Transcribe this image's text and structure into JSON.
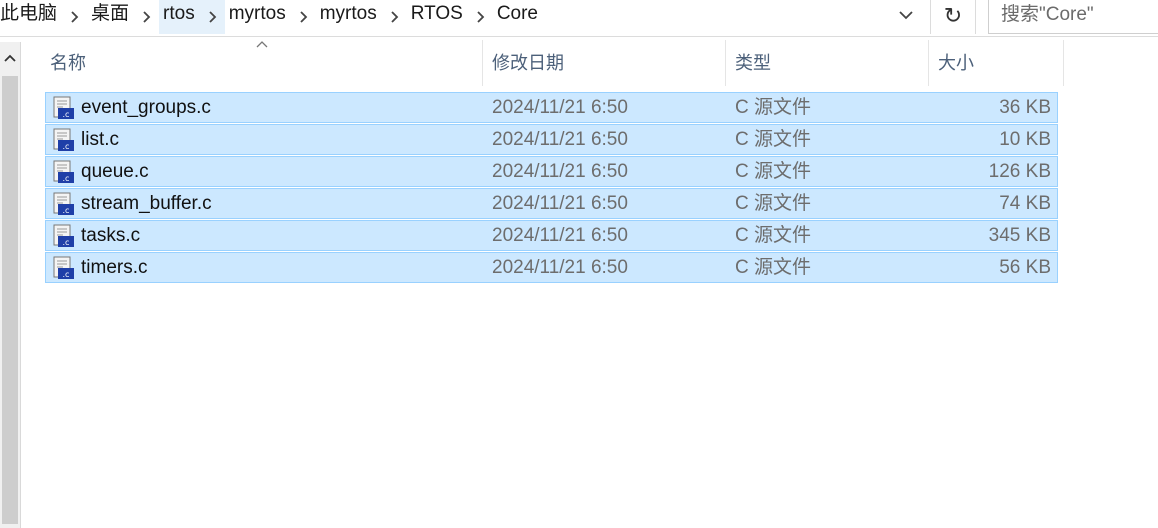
{
  "address_bar": {
    "crumbs": [
      "此电脑",
      "桌面",
      "rtos",
      "myrtos",
      "myrtos",
      "RTOS",
      "Core"
    ],
    "history_icon": "chevron-down-icon",
    "refresh_icon": "refresh-icon",
    "refresh_glyph": "↻"
  },
  "search": {
    "placeholder": "搜索\"Core\""
  },
  "columns": {
    "name": "名称",
    "date": "修改日期",
    "type": "类型",
    "size": "大小",
    "sort_indicator": "^"
  },
  "files": [
    {
      "name": "event_groups.c",
      "date": "2024/11/21 6:50",
      "type": "C 源文件",
      "size": "36 KB"
    },
    {
      "name": "list.c",
      "date": "2024/11/21 6:50",
      "type": "C 源文件",
      "size": "10 KB"
    },
    {
      "name": "queue.c",
      "date": "2024/11/21 6:50",
      "type": "C 源文件",
      "size": "126 KB"
    },
    {
      "name": "stream_buffer.c",
      "date": "2024/11/21 6:50",
      "type": "C 源文件",
      "size": "74 KB"
    },
    {
      "name": "tasks.c",
      "date": "2024/11/21 6:50",
      "type": "C 源文件",
      "size": "345 KB"
    },
    {
      "name": "timers.c",
      "date": "2024/11/21 6:50",
      "type": "C 源文件",
      "size": "56 KB"
    }
  ],
  "colors": {
    "selection_fill": "#cce8ff",
    "selection_border": "#99d1ff",
    "header_text": "#4c607a"
  }
}
